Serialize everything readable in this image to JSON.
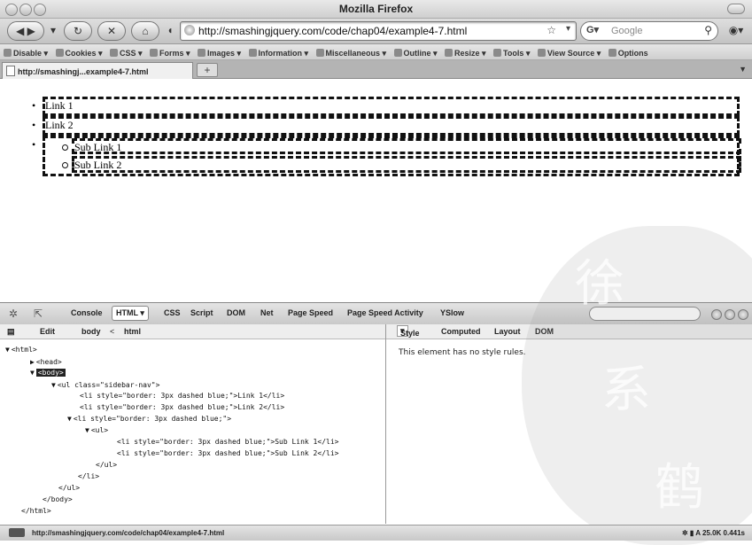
{
  "window": {
    "title": "Mozilla Firefox"
  },
  "nav": {
    "url": "http://smashingjquery.com/code/chap04/example4-7.html",
    "search_engine": "Google",
    "back_icon": "back-arrow-icon",
    "forward_icon": "forward-arrow-icon"
  },
  "devbar": {
    "items": [
      "Disable",
      "Cookies",
      "CSS",
      "Forms",
      "Images",
      "Information",
      "Miscellaneous",
      "Outline",
      "Resize",
      "Tools",
      "View Source",
      "Options"
    ]
  },
  "tabs": {
    "active_label": "http://smashingj...example4-7.html",
    "add_label": "+"
  },
  "page": {
    "top_items": [
      "Link 1",
      "Link 2"
    ],
    "sub_items": [
      "Sub Link 1",
      "Sub Link 2"
    ]
  },
  "firebug": {
    "tabs": [
      "Console",
      "HTML",
      "CSS",
      "Script",
      "DOM",
      "Net",
      "Page Speed",
      "Page Speed Activity",
      "YSlow"
    ],
    "active_tab": "HTML",
    "html_toolbar": {
      "edit": "Edit",
      "crumb_1": "body",
      "sep": "<",
      "crumb_2": "html"
    },
    "side_tabs": [
      "Style",
      "Computed",
      "Layout",
      "DOM"
    ],
    "active_side_tab": "Style",
    "style_message": "This element has no style rules.",
    "tree": [
      "<html>",
      "<head>",
      "<body>",
      "<ul class=\"sidebar-nav\">",
      "<li style=\"border: 3px dashed blue;\">Link 1</li>",
      "<li style=\"border: 3px dashed blue;\">Link 2</li>",
      "<li style=\"border: 3px dashed blue;\">",
      "<ul>",
      "<li style=\"border: 3px dashed blue;\">Sub Link 1</li>",
      "<li style=\"border: 3px dashed blue;\">Sub Link 2</li>",
      "</ul>",
      "</li>",
      "</ul>",
      "</body>",
      "</html>"
    ]
  },
  "status": {
    "url": "http://smashingjquery.com/code/chap04/example4-7.html",
    "size": "A  25.0K  0.441s"
  }
}
